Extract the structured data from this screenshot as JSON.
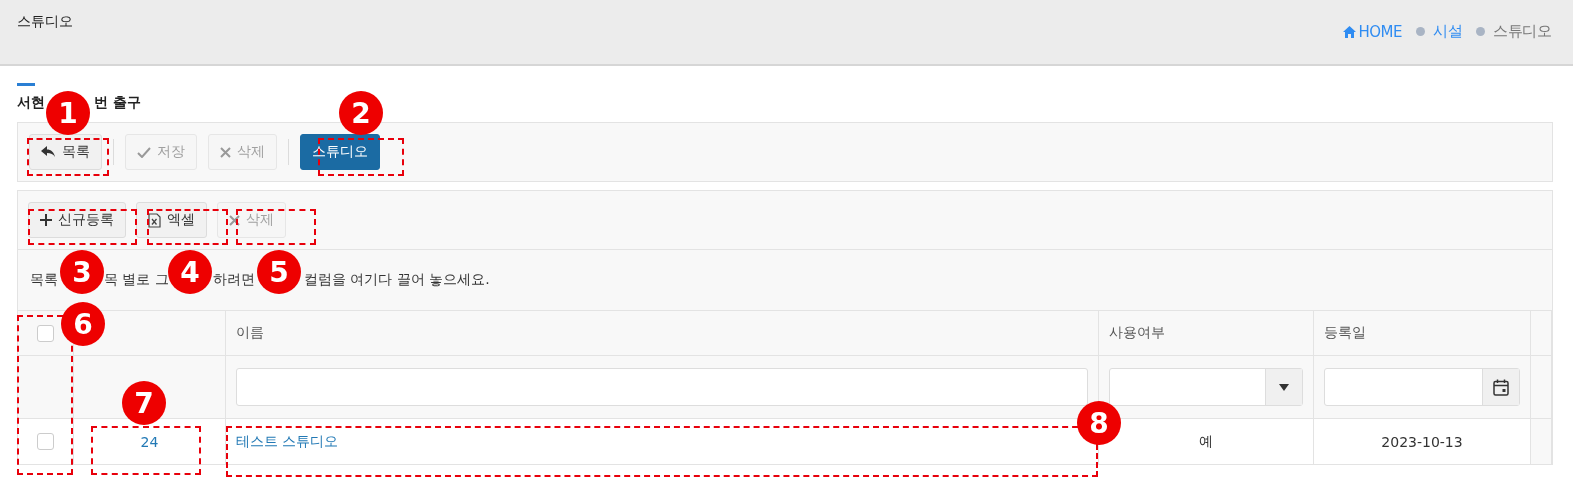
{
  "page_header": {
    "title": "스튜디오",
    "breadcrumb": [
      {
        "label": "HOME",
        "kind": "home"
      },
      {
        "label": "시설",
        "kind": "link"
      },
      {
        "label": "스튜디오",
        "kind": "current"
      }
    ]
  },
  "section_title_parts": [
    "서현",
    "번 출구"
  ],
  "toolbar_groups": [
    [
      {
        "label": "목록",
        "disabled": false,
        "primary": false
      }
    ],
    [
      {
        "label": "저장",
        "disabled": true,
        "primary": false
      },
      {
        "label": "삭제",
        "disabled": true,
        "primary": false
      }
    ],
    [
      {
        "label": "스튜디오",
        "disabled": false,
        "primary": true
      }
    ]
  ],
  "grid_toolbar": [
    {
      "label": "신규등록",
      "disabled": false
    },
    {
      "label": "엑셀",
      "disabled": false
    },
    {
      "label": "삭제",
      "disabled": true
    }
  ],
  "group_hint_parts": [
    "목록",
    "목 별로 그",
    "하려면",
    "컬럼을 여기다 끌어 놓으세요."
  ],
  "table": {
    "select_all": {
      "checked": false
    },
    "columns": [
      {
        "label": "이름",
        "kind": "text"
      },
      {
        "label": "사용여부",
        "kind": "select"
      },
      {
        "label": "등록일",
        "kind": "date"
      }
    ],
    "rows": [
      {
        "checked": false,
        "number": "24",
        "name": "테스트 스튜디오",
        "in_use": "예",
        "registered": "2023-10-13"
      }
    ]
  },
  "annotations": [
    "1",
    "2",
    "3",
    "4",
    "5",
    "6",
    "7",
    "8"
  ]
}
